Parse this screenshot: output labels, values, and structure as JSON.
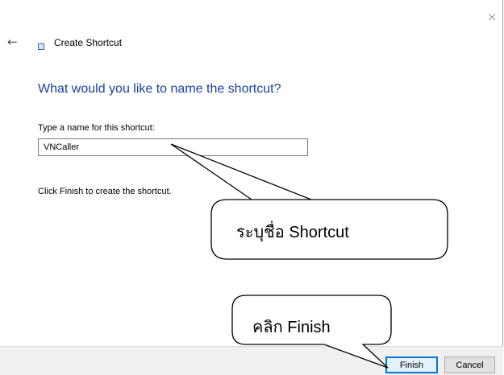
{
  "window": {
    "title": "Create Shortcut",
    "close_glyph": "×",
    "back_glyph": "←"
  },
  "main": {
    "heading": "What would you like to name the shortcut?",
    "field_label": "Type a name for this shortcut:",
    "field_value": "VNCaller",
    "info": "Click Finish to create the shortcut."
  },
  "footer": {
    "finish_label": "Finish",
    "cancel_label": "Cancel"
  },
  "annotations": {
    "name_callout": "ระบุชื่อ Shortcut",
    "finish_callout": "คลิก Finish"
  },
  "colors": {
    "heading": "#1c3fa0",
    "accent": "#0078d7",
    "footer_bg": "#f0f0f0"
  },
  "icons": [
    "back-arrow-icon",
    "close-icon",
    "shortcut-wizard-icon"
  ]
}
